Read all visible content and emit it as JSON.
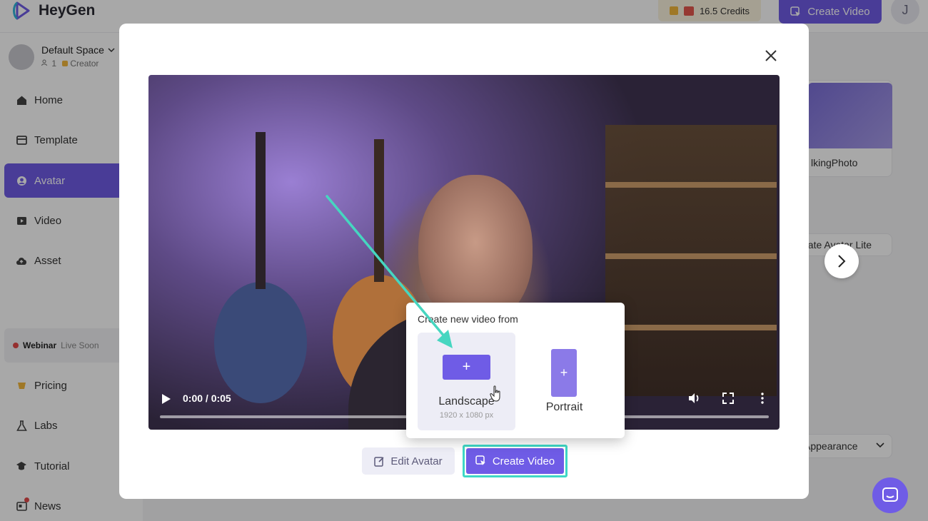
{
  "app": {
    "name": "HeyGen"
  },
  "header": {
    "credits_label": "16.5 Credits",
    "create_video_label": "Create Video",
    "user_initial": "J"
  },
  "sidebar": {
    "space_name": "Default Space",
    "member_count": "1",
    "plan": "Creator",
    "items": [
      {
        "label": "Home",
        "icon": "home-icon"
      },
      {
        "label": "Template",
        "icon": "template-icon"
      },
      {
        "label": "Avatar",
        "icon": "avatar-icon",
        "active": true
      },
      {
        "label": "Video",
        "icon": "video-icon"
      },
      {
        "label": "Asset",
        "icon": "cloud-icon"
      },
      {
        "label": "Pricing",
        "icon": "coin-icon"
      },
      {
        "label": "Labs",
        "icon": "flask-icon"
      },
      {
        "label": "Tutorial",
        "icon": "graduation-cap-icon"
      },
      {
        "label": "News",
        "icon": "news-icon"
      }
    ],
    "webinar_label": "Webinar",
    "webinar_status": "Live Soon"
  },
  "background": {
    "talking_photo_label": "lkingPhoto",
    "create_avatar_lite_label": "eate Avatar Lite",
    "appearance_label": "Appearance"
  },
  "modal": {
    "video": {
      "time": "0:00 / 0:05",
      "progress_fraction": 0.0
    },
    "popup": {
      "title": "Create new video from",
      "landscape_label": "Landscape",
      "landscape_size": "1920 x 1080 px",
      "portrait_label": "Portrait"
    },
    "edit_avatar_label": "Edit Avatar",
    "create_video_label": "Create Video"
  },
  "colors": {
    "accent": "#6f5ce6",
    "highlight": "#3ed8c6"
  }
}
